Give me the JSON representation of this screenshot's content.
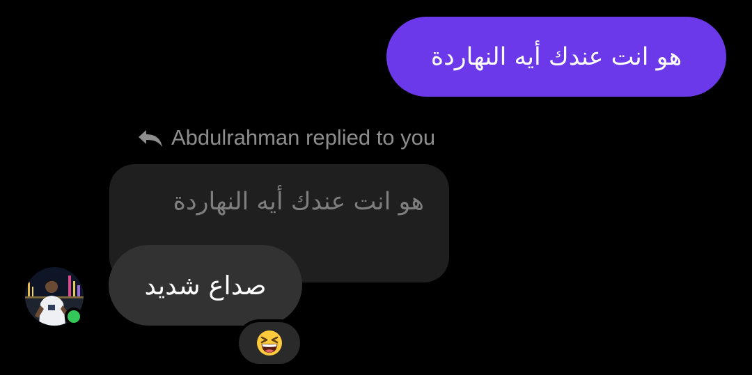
{
  "conversation": {
    "sent_message": {
      "text": "هو انت عندك أيه النهاردة",
      "bubble_color": "#6b39ea"
    },
    "reply_indicator": {
      "icon": "reply-arrow-icon",
      "label": "Abdulrahman replied to you"
    },
    "quoted_message": {
      "text": "هو انت عندك أيه النهاردة"
    },
    "received_message": {
      "text": "صداع شديد",
      "reaction": {
        "icon": "grinning-squinting-face-emoji"
      }
    },
    "contact": {
      "avatar_icon": "profile-photo",
      "status_color": "#34c759"
    }
  }
}
